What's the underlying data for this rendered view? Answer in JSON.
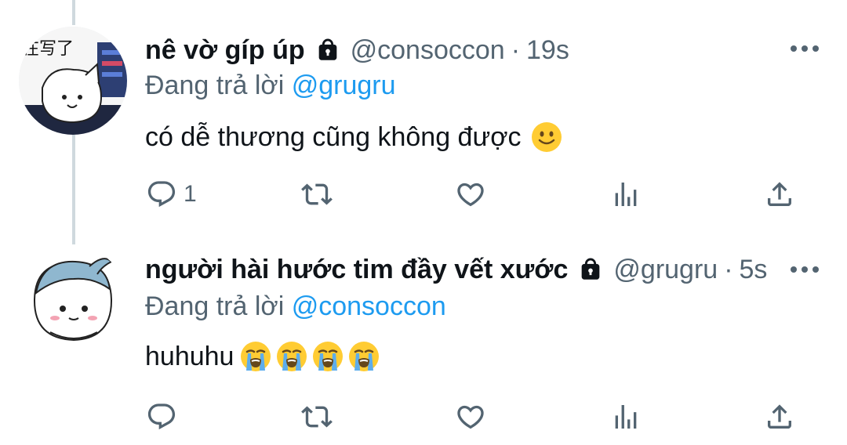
{
  "tweets": [
    {
      "display_name": "nê vờ gíp úp",
      "handle": "@consoccon",
      "separator": "·",
      "time": "19s",
      "reply_prefix": "Đang trả lời",
      "reply_to": "@grugru",
      "text": "có dễ thương cũng không được",
      "emoji": [
        "slightly-smiling-face"
      ],
      "reply_count": "1",
      "avatar_text": "在写了"
    },
    {
      "display_name": "người hài hước tim đầy vết xước",
      "handle": "@grugru",
      "separator": "·",
      "time": "5s",
      "reply_prefix": "Đang trả lời",
      "reply_to": "@consoccon",
      "text": "huhuhu",
      "emoji": [
        "loudly-crying-face",
        "loudly-crying-face",
        "loudly-crying-face",
        "loudly-crying-face"
      ],
      "reply_count": ""
    }
  ],
  "colors": {
    "text": "#0f1419",
    "secondary": "#536471",
    "link": "#1d9bf0",
    "thread": "#cfd9de",
    "emoji": "#ffcc33"
  }
}
